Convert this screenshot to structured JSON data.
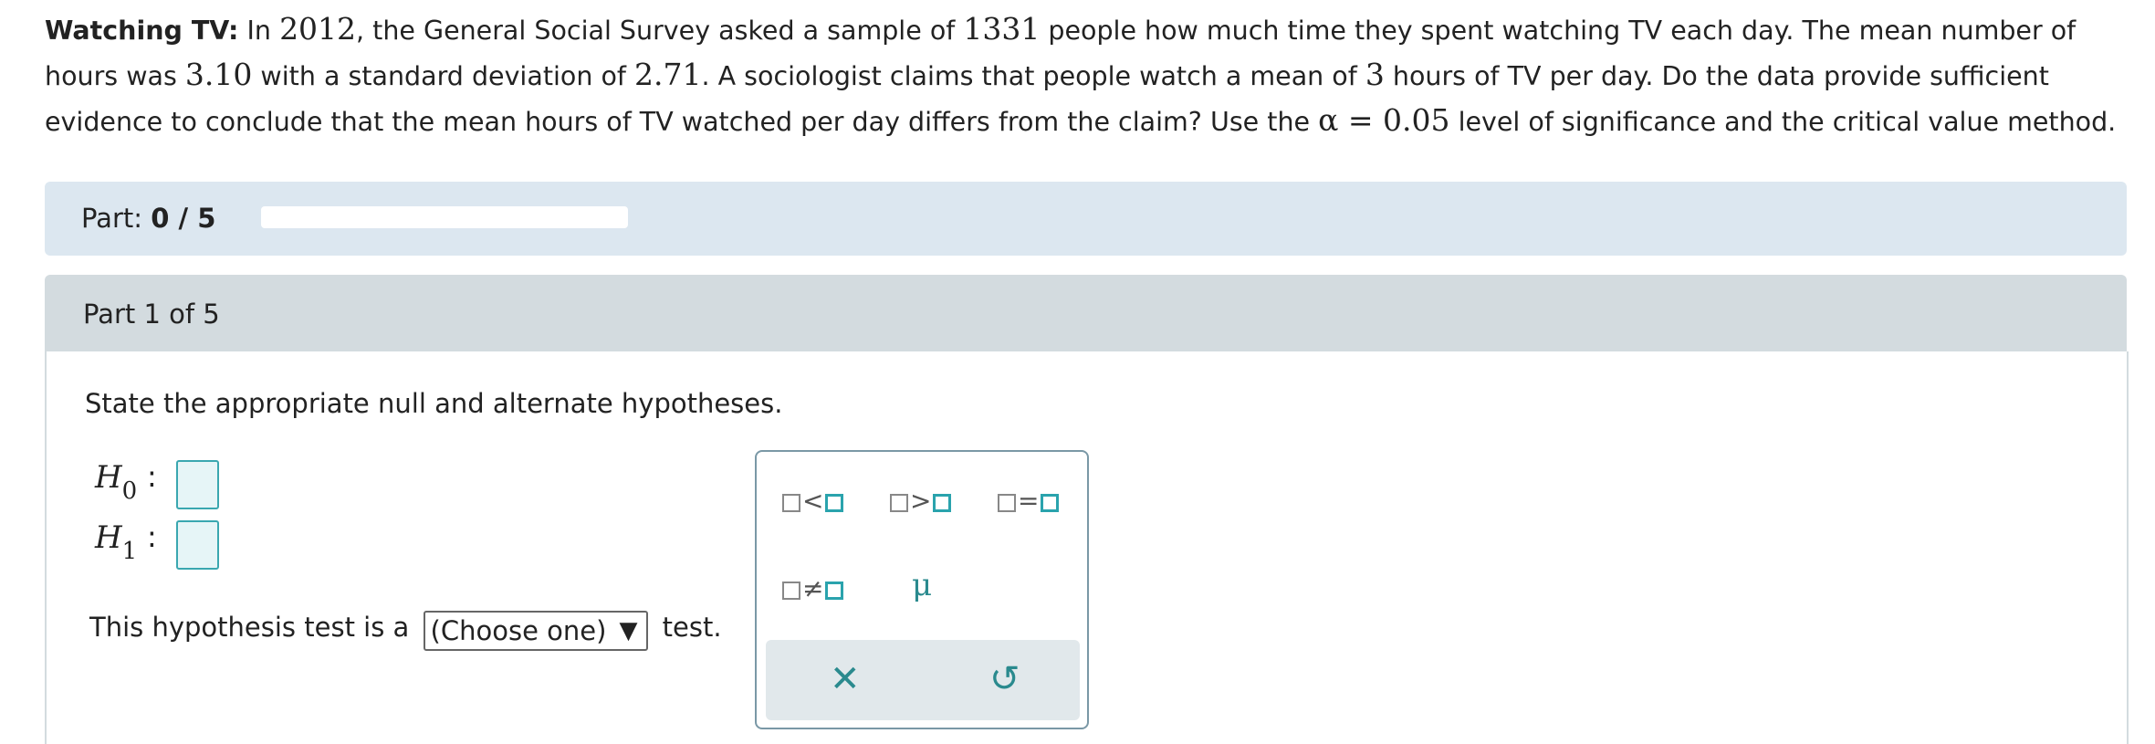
{
  "problem": {
    "title": "Watching TV:",
    "t1": " In ",
    "year": "2012",
    "t2": ", the General Social Survey asked a sample of ",
    "n": "1331",
    "t3": " people how much time they spent watching TV each day. The mean number of hours was ",
    "mean": "3.10",
    "t4": " with a standard deviation of ",
    "sd": "2.71",
    "t5": ". A sociologist claims that people watch a mean of ",
    "claim": "3",
    "t6": " hours of TV per day. Do the data provide sufficient evidence to conclude that the mean hours of TV watched per day differs from the claim? Use the ",
    "alpha": "α = 0.05",
    "t7": " level of significance and the critical value method."
  },
  "progress": {
    "label": "Part: ",
    "value": "0 / 5",
    "fraction": 0
  },
  "part": {
    "header": "Part 1 of 5",
    "instruction": "State the appropriate null and alternate hypotheses."
  },
  "hypotheses": {
    "h0": "H",
    "h0_sub": "0",
    "h1": "H",
    "h1_sub": "1",
    "colon": ":"
  },
  "test_line": {
    "before": "This hypothesis test is a",
    "select": "(Choose one)",
    "after": "test."
  },
  "palette": {
    "lt": "<",
    "gt": ">",
    "eq": "=",
    "ne": "≠",
    "mu": "μ",
    "clear": "✕",
    "undo": "↺"
  },
  "colors": {
    "accent": "#2aa3ad",
    "panel": "#dce7f0",
    "header": "#d3dbdf"
  }
}
